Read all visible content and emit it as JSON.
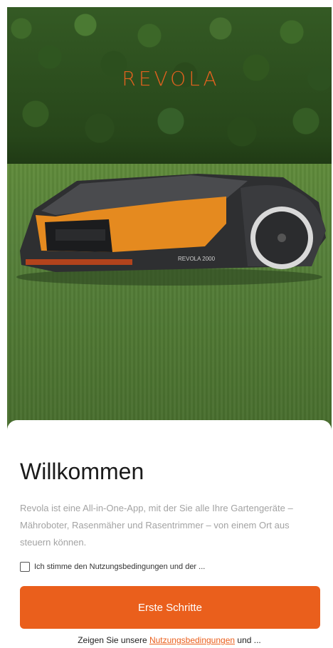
{
  "hero": {
    "brand_logo": "REVOLA",
    "mower_model_text": "REVOLA 2000"
  },
  "welcome": {
    "title": "Willkommen",
    "description": "Revola ist eine All-in-One-App, mit der Sie alle Ihre Gartengeräte – Mähroboter, Rasenmäher und Rasentrimmer – von einem Ort aus steuern können.",
    "terms_checkbox_label": "Ich stimme den Nutzungsbedingungen und der ...",
    "terms_checked": false,
    "cta_label": "Erste Schritte",
    "footer_prefix": "Zeigen Sie unsere ",
    "footer_link": "Nutzungsbedingungen",
    "footer_suffix": " und ..."
  },
  "colors": {
    "accent": "#ea5f1c",
    "logo": "#e2611f",
    "mower_orange": "#e58a1f"
  }
}
